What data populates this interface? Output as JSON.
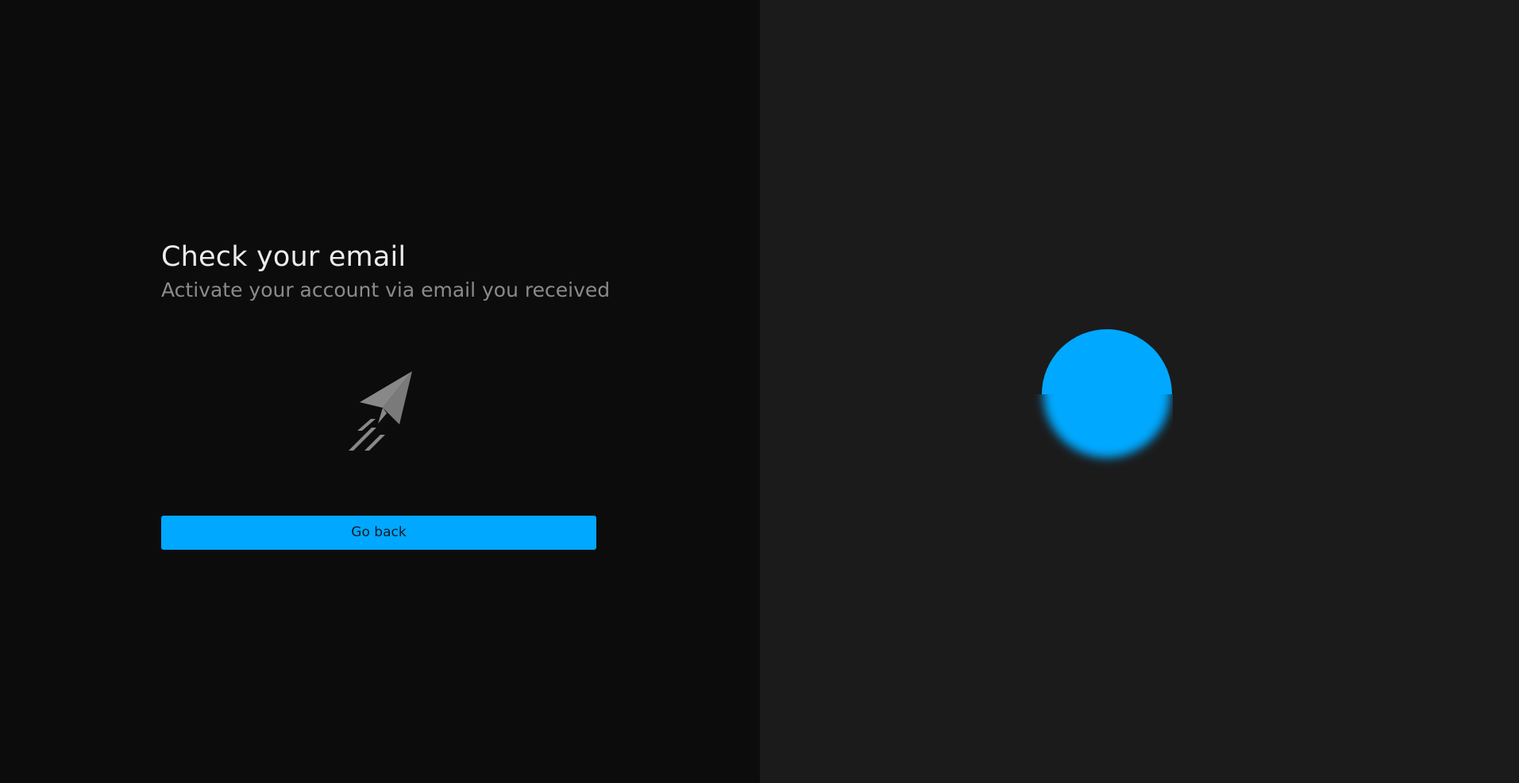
{
  "heading": {
    "title": "Check your email",
    "subtitle": "Activate your account via email you received"
  },
  "illustration": {
    "icon": "paper-plane-icon",
    "color": "#888888"
  },
  "actions": {
    "go_back_label": "Go back"
  },
  "decor": {
    "orb_icon": "glowing-orb",
    "accent_color": "#00a8ff"
  },
  "colors": {
    "left_background": "#0c0c0c",
    "right_background": "#1b1b1b",
    "title": "#ececec",
    "subtitle": "#8a8a8a"
  }
}
